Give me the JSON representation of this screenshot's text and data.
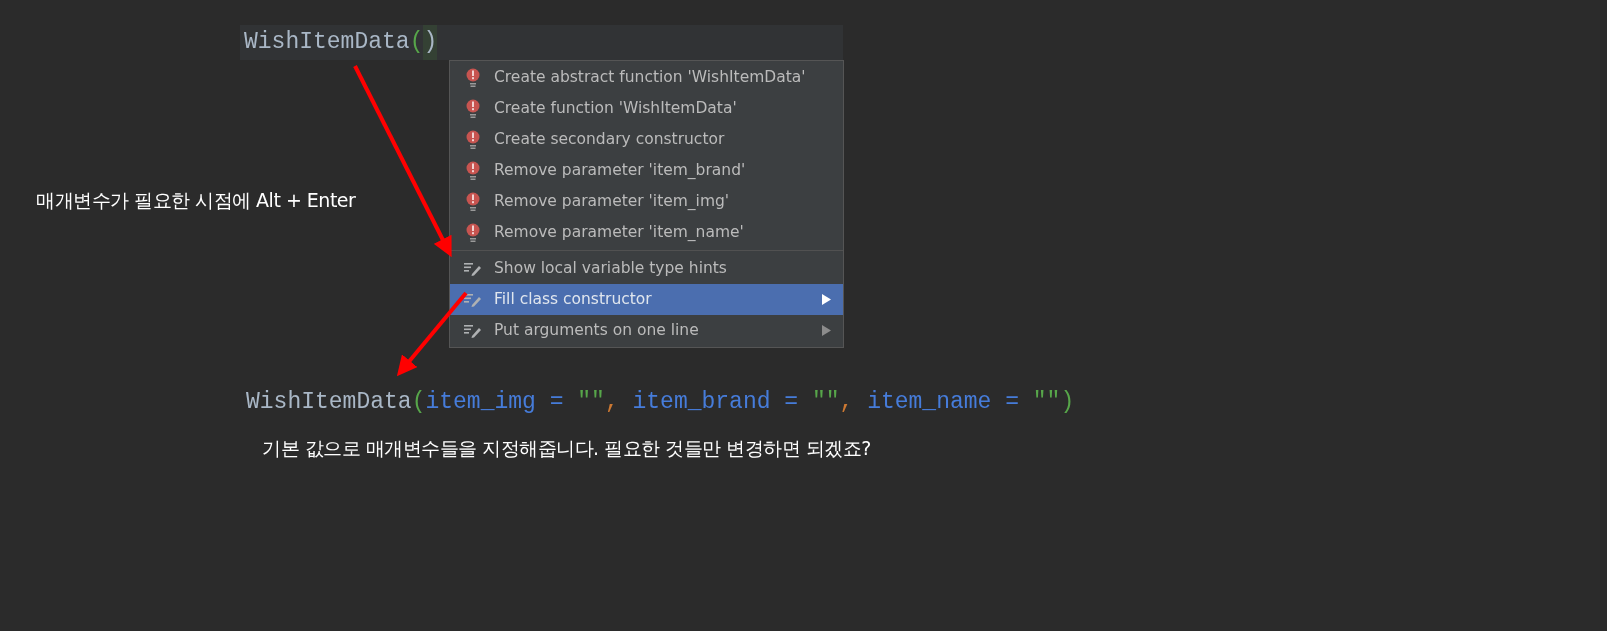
{
  "top_code": [
    {
      "kind": "name",
      "text": "WishItemData"
    },
    {
      "kind": "paren",
      "text": "("
    },
    {
      "kind": "paren_close",
      "text": ")"
    }
  ],
  "menu": [
    {
      "kind": "error",
      "label": "Create abstract function 'WishItemData'",
      "selected": false,
      "submenu": false
    },
    {
      "kind": "error",
      "label": "Create function 'WishItemData'",
      "selected": false,
      "submenu": false
    },
    {
      "kind": "error",
      "label": "Create secondary constructor",
      "selected": false,
      "submenu": false
    },
    {
      "kind": "error",
      "label": "Remove parameter 'item_brand'",
      "selected": false,
      "submenu": false
    },
    {
      "kind": "error",
      "label": "Remove parameter 'item_img'",
      "selected": false,
      "submenu": false
    },
    {
      "kind": "error",
      "label": "Remove parameter 'item_name'",
      "selected": false,
      "submenu": false
    },
    {
      "kind": "intention",
      "label": "Show local variable type hints",
      "selected": false,
      "submenu": false
    },
    {
      "kind": "intention",
      "label": "Fill class constructor",
      "selected": true,
      "submenu": true
    },
    {
      "kind": "intention",
      "label": "Put arguments on one line",
      "selected": false,
      "submenu": true
    }
  ],
  "annotation_1": "매개변수가 필요한 시점에 Alt + Enter",
  "result_code": [
    {
      "kind": "name",
      "text": "WishItemData"
    },
    {
      "kind": "paren",
      "text": "("
    },
    {
      "kind": "param",
      "text": "item_img = "
    },
    {
      "kind": "string",
      "text": "\"\""
    },
    {
      "kind": "comma",
      "text": ", "
    },
    {
      "kind": "param",
      "text": "item_brand = "
    },
    {
      "kind": "string",
      "text": "\"\""
    },
    {
      "kind": "comma",
      "text": ", "
    },
    {
      "kind": "param",
      "text": "item_name = "
    },
    {
      "kind": "string",
      "text": "\"\")"
    }
  ],
  "annotation_2": "기본 값으로 매개변수들을 지정해줍니다. 필요한 것들만 변경하면 되겠죠?"
}
